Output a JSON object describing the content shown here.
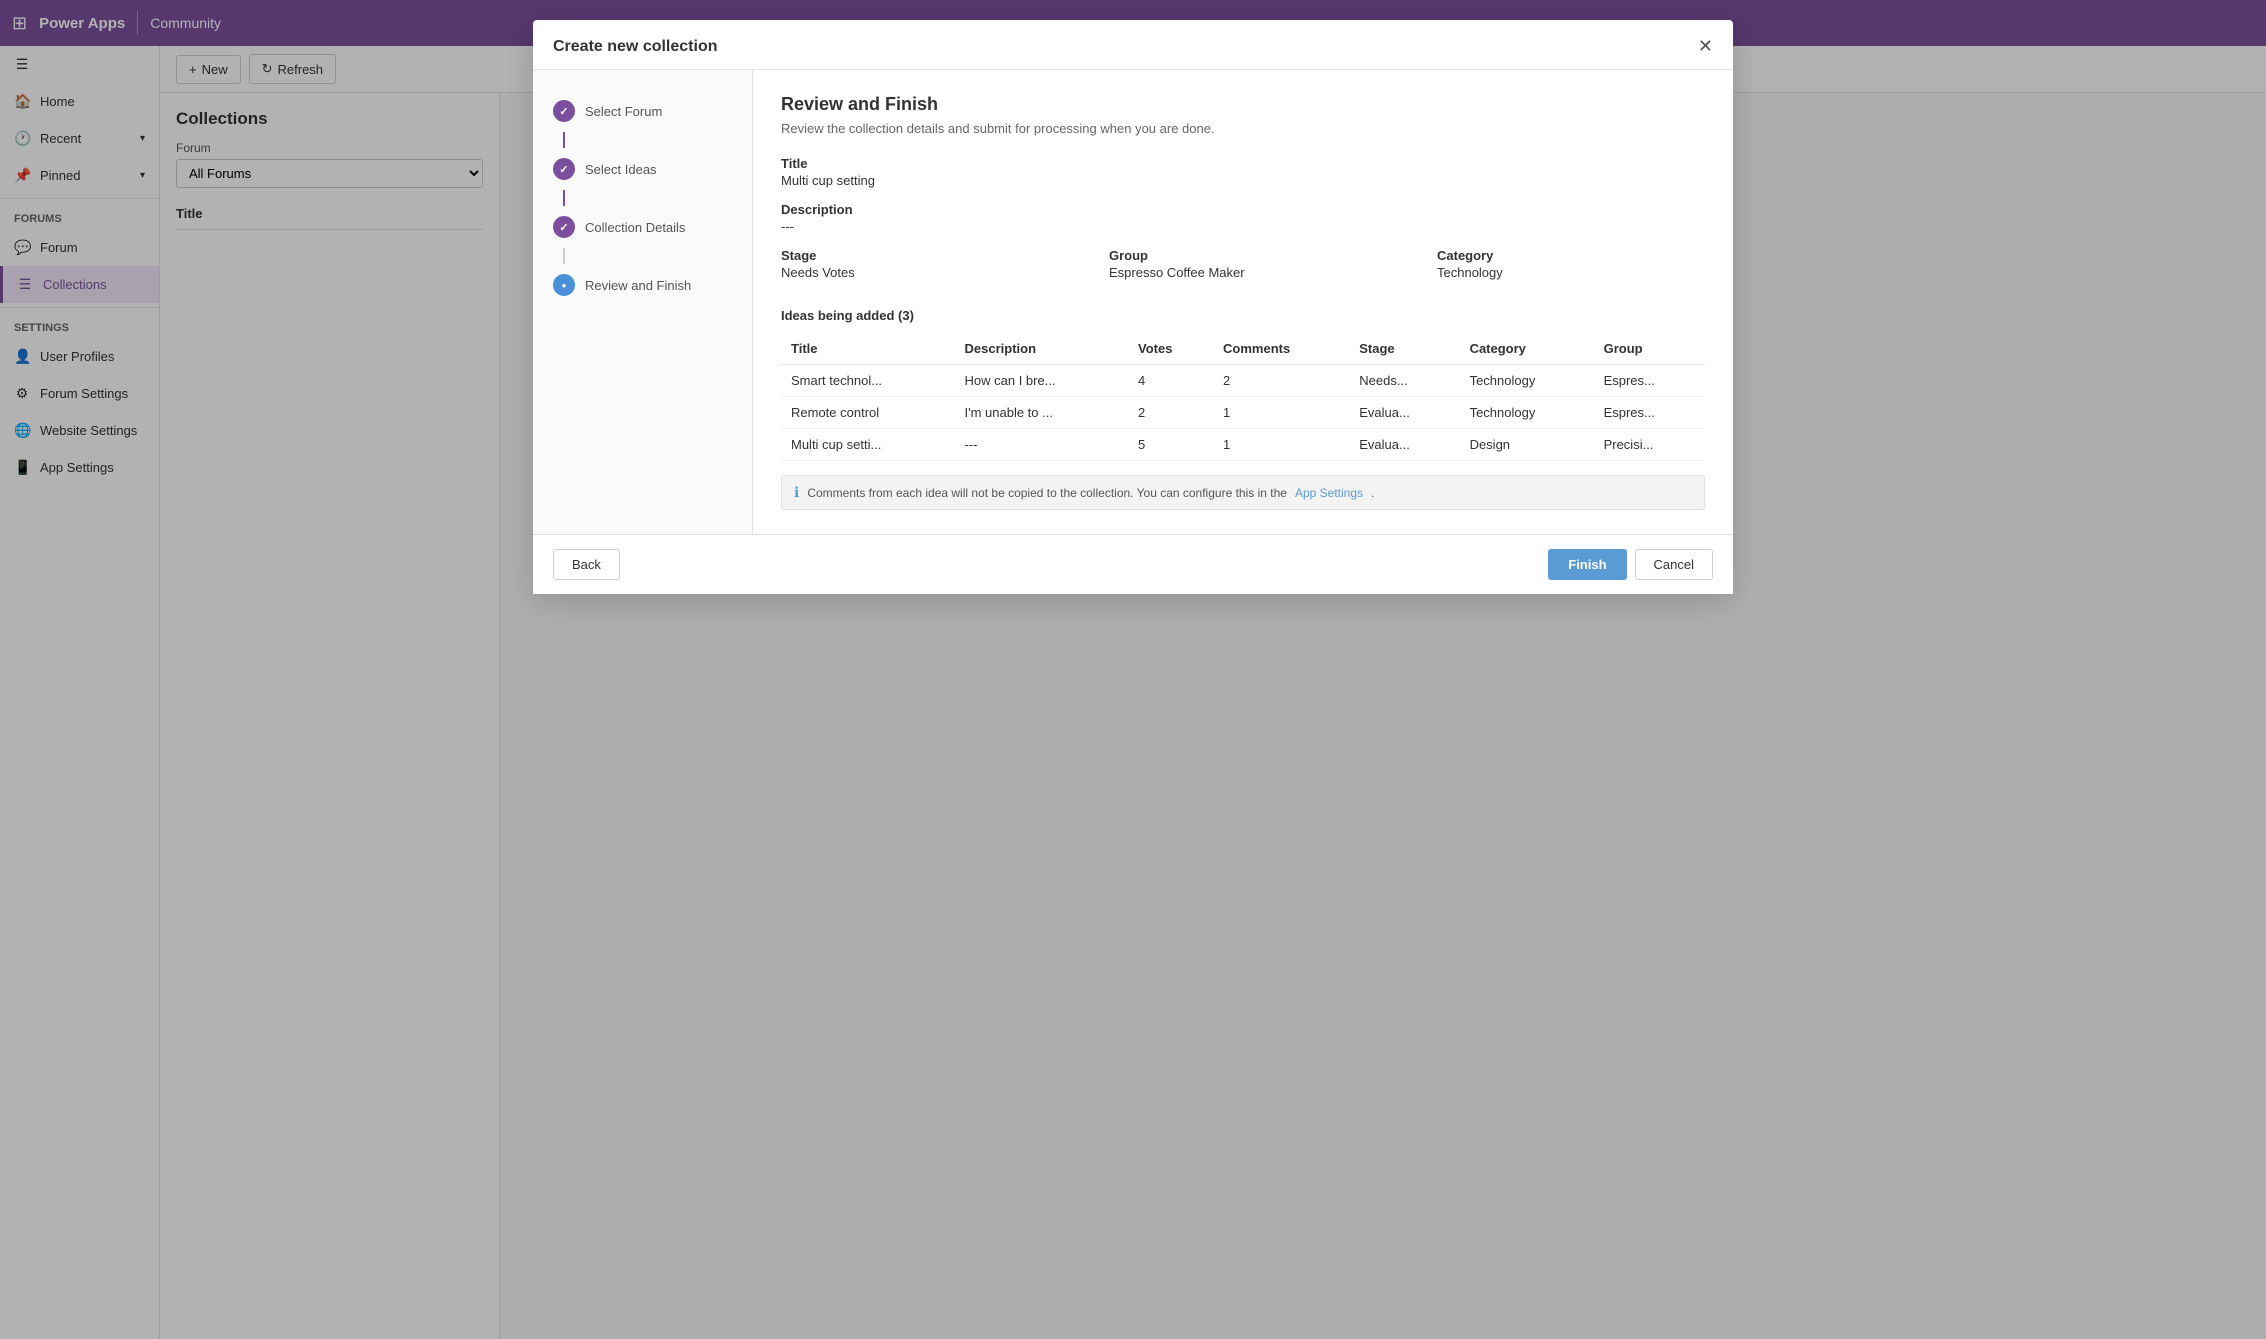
{
  "topbar": {
    "grid_icon": "⊞",
    "logo": "Power Apps",
    "divider": true,
    "app_name": "Community"
  },
  "sidebar": {
    "collapse_icon": "☰",
    "items": [
      {
        "id": "home",
        "icon": "🏠",
        "label": "Home",
        "active": false
      },
      {
        "id": "recent",
        "icon": "🕐",
        "label": "Recent",
        "chevron": "▾",
        "active": false
      },
      {
        "id": "pinned",
        "icon": "📌",
        "label": "Pinned",
        "chevron": "▾",
        "active": false
      }
    ],
    "forums_section": "Forums",
    "forums_items": [
      {
        "id": "forum",
        "icon": "💬",
        "label": "Forum",
        "active": false
      },
      {
        "id": "collections",
        "icon": "☰",
        "label": "Collections",
        "active": true
      }
    ],
    "settings_section": "Settings",
    "settings_items": [
      {
        "id": "user-profiles",
        "icon": "👤",
        "label": "User Profiles",
        "active": false
      },
      {
        "id": "forum-settings",
        "icon": "⚙",
        "label": "Forum Settings",
        "active": false
      },
      {
        "id": "website-settings",
        "icon": "🌐",
        "label": "Website Settings",
        "active": false
      },
      {
        "id": "app-settings",
        "icon": "📱",
        "label": "App Settings",
        "active": false
      }
    ]
  },
  "toolbar": {
    "new_label": "New",
    "new_icon": "+",
    "refresh_label": "Refresh",
    "refresh_icon": "↻"
  },
  "collections": {
    "title": "Collections",
    "forum_filter_label": "Forum",
    "forum_filter_value": "All Forums",
    "forum_filter_placeholder": "All Forums",
    "table_header": "Title"
  },
  "modal": {
    "title": "Create new collection",
    "close_icon": "✕",
    "wizard_steps": [
      {
        "id": "select-forum",
        "label": "Select Forum",
        "state": "completed"
      },
      {
        "id": "select-ideas",
        "label": "Select Ideas",
        "state": "completed"
      },
      {
        "id": "collection-details",
        "label": "Collection Details",
        "state": "completed"
      },
      {
        "id": "review-finish",
        "label": "Review and Finish",
        "state": "active"
      }
    ],
    "review": {
      "heading": "Review and Finish",
      "subtitle": "Review the collection details and submit for processing when you are done.",
      "title_label": "Title",
      "title_value": "Multi cup setting",
      "description_label": "Description",
      "description_value": "---",
      "stage_label": "Stage",
      "stage_value": "Needs Votes",
      "group_label": "Group",
      "group_value": "Espresso Coffee Maker",
      "category_label": "Category",
      "category_value": "Technology",
      "ideas_header": "Ideas being added (3)",
      "table_columns": [
        "Title",
        "Description",
        "Votes",
        "Comments",
        "Stage",
        "Category",
        "Group"
      ],
      "table_rows": [
        {
          "title": "Smart technol...",
          "description": "How can I bre...",
          "votes": "4",
          "comments": "2",
          "stage": "Needs...",
          "category": "Technology",
          "group": "Espres..."
        },
        {
          "title": "Remote control",
          "description": "I'm unable to ...",
          "votes": "2",
          "comments": "1",
          "stage": "Evalua...",
          "category": "Technology",
          "group": "Espres..."
        },
        {
          "title": "Multi cup setti...",
          "description": "---",
          "votes": "5",
          "comments": "1",
          "stage": "Evalua...",
          "category": "Design",
          "group": "Precisi..."
        }
      ],
      "info_text": "Comments from each idea will not be copied to the collection. You can configure this in the",
      "info_link": "App Settings",
      "info_link_suffix": "."
    },
    "footer": {
      "back_label": "Back",
      "finish_label": "Finish",
      "cancel_label": "Cancel"
    }
  }
}
